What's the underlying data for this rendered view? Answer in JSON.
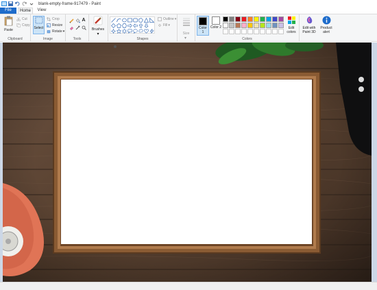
{
  "window": {
    "title": "blank-empty-frame-917479 - Paint"
  },
  "tabs": {
    "file": "File",
    "home": "Home",
    "view": "View"
  },
  "ribbon": {
    "clipboard": {
      "label": "Clipboard",
      "paste": "Paste",
      "cut": "Cut",
      "copy": "Copy"
    },
    "image": {
      "label": "Image",
      "select": "Select",
      "crop": "Crop",
      "resize": "Resize",
      "rotate": "Rotate"
    },
    "tools": {
      "label": "Tools",
      "text_tool": "A"
    },
    "brushes": {
      "label": "Brushes"
    },
    "shapes": {
      "label": "Shapes",
      "outline": "Outline",
      "fill": "Fill"
    },
    "size": {
      "label": "Size"
    },
    "colors": {
      "label": "Colors",
      "color1": "Color 1",
      "color2": "Color 2",
      "color1_value": "#000000",
      "color2_value": "#ffffff",
      "edit_colors": "Edit colors",
      "edit_paint3d": "Edit with Paint 3D",
      "product_alert": "Product alert",
      "palette_row1": [
        "#000000",
        "#7f7f7f",
        "#880015",
        "#ed1c24",
        "#ff7f27",
        "#fff200",
        "#22b14c",
        "#00a2e8",
        "#3f48cc",
        "#a349a4"
      ],
      "palette_row2": [
        "#ffffff",
        "#c3c3c3",
        "#b97a57",
        "#ffaec9",
        "#ffc90e",
        "#efe4b0",
        "#b5e61d",
        "#99d9ea",
        "#7092be",
        "#c8bfe7"
      ],
      "palette_row3": [
        "#ffffff",
        "#ffffff",
        "#ffffff",
        "#ffffff",
        "#ffffff",
        "#ffffff",
        "#ffffff",
        "#ffffff",
        "#ffffff",
        "#ffffff"
      ]
    }
  },
  "icons": {
    "paint_app": "paint-app-icon",
    "save": "save-icon",
    "undo": "undo-icon",
    "redo": "redo-icon",
    "pencil": "pencil-icon",
    "fill": "fill-bucket-icon",
    "eraser": "eraser-icon",
    "color_picker": "color-picker-icon",
    "magnifier": "magnifier-icon"
  },
  "colors": {
    "file_tab": "#1e6ccb",
    "select_bg": "#cce4f7",
    "canvas_bg": "#ccd7e6"
  }
}
